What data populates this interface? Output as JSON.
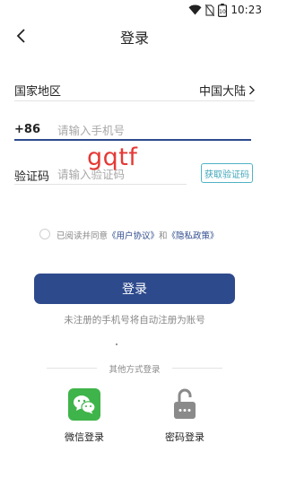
{
  "status_bar": {
    "time": "10:23",
    "icons": [
      "wifi-icon",
      "no-sim-icon",
      "battery-icon"
    ],
    "battery_level": "10"
  },
  "header": {
    "title": "登录",
    "back_icon": "chevron-left-icon"
  },
  "region": {
    "label": "国家地区",
    "value": "中国大陆",
    "arrow_icon": "chevron-right-icon"
  },
  "phone": {
    "country_code": "+86",
    "placeholder": "请输入手机号"
  },
  "verification": {
    "label": "验证码",
    "placeholder": "请输入验证码",
    "get_code_label": "获取验证码"
  },
  "watermark_text": "gqtf",
  "agreement": {
    "prefix": "已阅读并同意",
    "user_agreement": "《用户协议》",
    "and": "和",
    "privacy_policy": "《隐私政策》"
  },
  "login_button": "登录",
  "hint": "未注册的手机号将自动注册为账号",
  "other_login": {
    "title": "其他方式登录",
    "wechat_label": "微信登录",
    "wechat_icon": "wechat-icon",
    "password_label": "密码登录",
    "password_icon": "lock-icon"
  },
  "colors": {
    "primary": "#2d4a8c",
    "accent_teal": "#3fa5b8",
    "wechat_green": "#3fb44a",
    "watermark_red": "#e53935",
    "text_gray": "#888888"
  }
}
